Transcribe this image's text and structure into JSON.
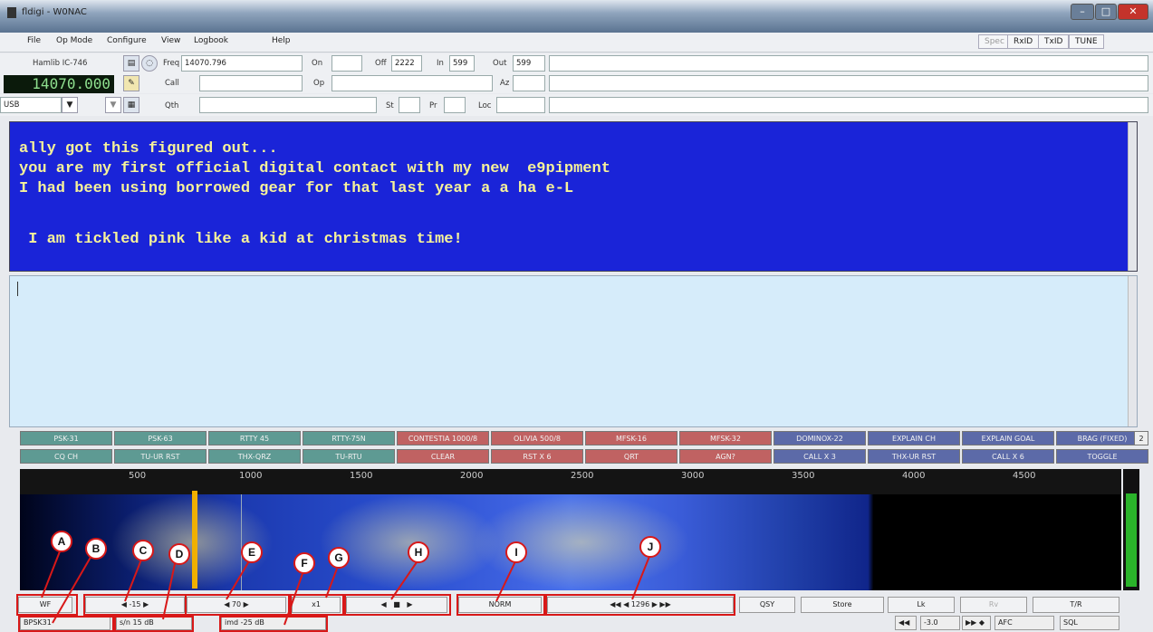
{
  "window": {
    "title": "fldigi - W0NAC"
  },
  "menu": {
    "items": [
      "File",
      "Op Mode",
      "Configure",
      "View",
      "Logbook",
      "Help"
    ],
    "right": [
      "Spec",
      "RxID",
      "TxID",
      "TUNE"
    ]
  },
  "rig": {
    "name": "Hamlib IC-746",
    "frequency": "14070.000",
    "mode": "USB"
  },
  "log": {
    "freq_label": "Freq",
    "freq": "14070.796",
    "on_label": "On",
    "off_label": "Off",
    "off": "2222",
    "in_label": "In",
    "in": "599",
    "out_label": "Out",
    "out": "599",
    "call_label": "Call",
    "op_label": "Op",
    "az_label": "Az",
    "qth_label": "Qth",
    "st_label": "St",
    "pr_label": "Pr",
    "loc_label": "Loc"
  },
  "rx_text": [
    "ally got this figured out...",
    "you are my first official digital contact with my new  e9pipment",
    "I had been using borrowed gear for that last year a a ha e-L",
    "",
    " I am tickled pink like a kid at christmas time!"
  ],
  "macros": {
    "row1": [
      "PSK-31",
      "PSK-63",
      "RTTY 45",
      "RTTY-75N",
      "CONTESTIA 1000/8",
      "OLIVIA 500/8",
      "MFSK-16",
      "MFSK-32",
      "DOMINOX-22",
      "EXPLAIN CH",
      "EXPLAIN GOAL",
      "BRAG (FIXED)"
    ],
    "row2": [
      "CQ CH",
      "TU-UR RST",
      "THX-QRZ",
      "TU-RTU",
      "CLEAR",
      "RST X 6",
      "QRT",
      "AGN?",
      "CALL X 3",
      "THX-UR RST",
      "CALL X 6",
      "TOGGLE"
    ],
    "set": "2",
    "colors": [
      "#5e9a93",
      "#c06262",
      "#5c6aa8"
    ]
  },
  "scale": {
    "ticks": [
      "500",
      "1000",
      "1500",
      "2000",
      "2500",
      "3000",
      "3500",
      "4000",
      "4500"
    ]
  },
  "controls": {
    "wf": "WF",
    "val_c": "-15",
    "val_e": "70",
    "val_g": "x1",
    "norm": "NORM",
    "val_j": "1296",
    "qsy": "QSY",
    "store": "Store",
    "lk": "Lk",
    "rv": "Rv",
    "tr": "T/R"
  },
  "status": {
    "mode": "BPSK31",
    "sn": "s/n 15 dB",
    "imd": "imd -25 dB",
    "afc_val": "-3.0",
    "afc": "AFC",
    "sql": "SQL"
  },
  "callouts": [
    "A",
    "B",
    "C",
    "D",
    "E",
    "F",
    "G",
    "H",
    "I",
    "J"
  ],
  "signal_level": 0.82
}
